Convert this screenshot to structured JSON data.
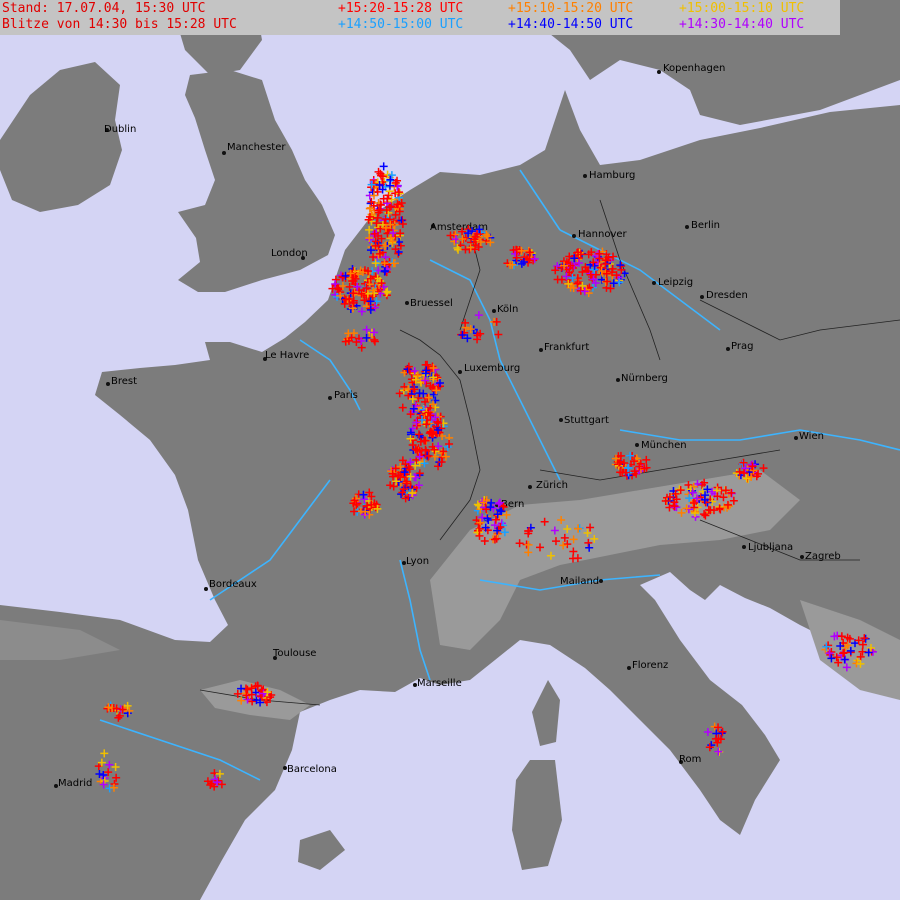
{
  "header": {
    "stand": "Stand: 17.07.04, 15:30 UTC",
    "range": "Blitze von 14:30 bis 15:28 UTC",
    "text_color": "#e00000"
  },
  "legend": [
    {
      "label": "15:20-15:28 UTC",
      "color": "#ff0000"
    },
    {
      "label": "15:10-15:20 UTC",
      "color": "#ff8000"
    },
    {
      "label": "15:00-15:10 UTC",
      "color": "#f0c000"
    },
    {
      "label": "14:50-15:00 UTC",
      "color": "#1aa0ff"
    },
    {
      "label": "14:40-14:50 UTC",
      "color": "#0000ff"
    },
    {
      "label": "14:30-14:40 UTC",
      "color": "#b000ff"
    }
  ],
  "colors": {
    "sea": "#d4d4f4",
    "land": "#7c7c7c",
    "mountain_light": "#d8d8d8",
    "mountain_dark": "#3a3a3a",
    "river": "#3db4ff",
    "border": "#222222",
    "header_bg": "#c4c4c4"
  },
  "cities": [
    "Dublin",
    "Manchester",
    "London",
    "Amsterdam",
    "Hamburg",
    "Kopenhagen",
    "Hannover",
    "Berlin",
    "Leipzig",
    "Dresden",
    "Köln",
    "Bruessel",
    "Le Havre",
    "Brest",
    "Paris",
    "Luxemburg",
    "Frankfurt",
    "Prag",
    "Nürnberg",
    "Stuttgart",
    "Wien",
    "München",
    "Zürich",
    "Bern",
    "Lyon",
    "Bordeaux",
    "Mailand",
    "Ljubljana",
    "Zagreb",
    "Toulouse",
    "Marseille",
    "Florenz",
    "Barcelona",
    "Rom",
    "Madrid"
  ]
}
